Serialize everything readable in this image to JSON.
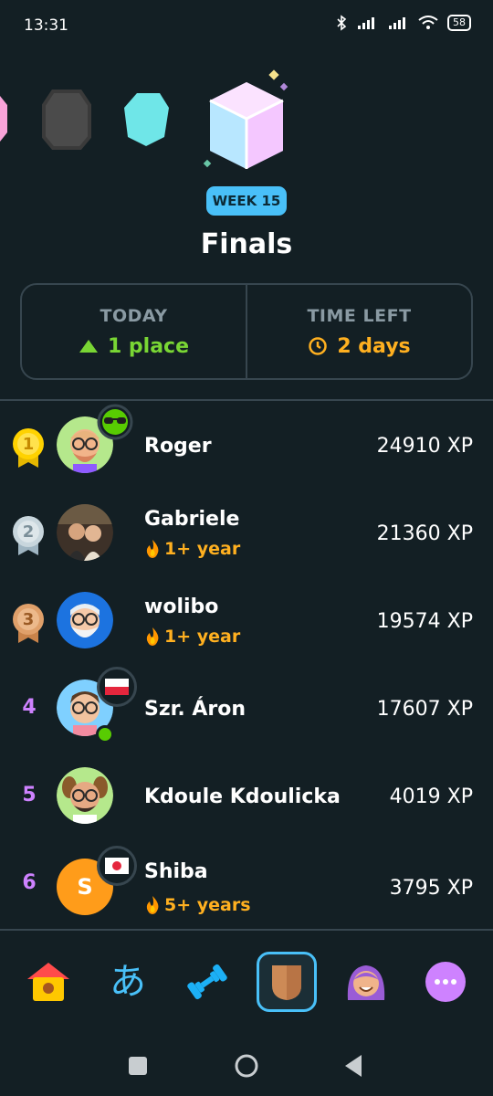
{
  "status_bar": {
    "time": "13:31",
    "battery": "58"
  },
  "league": {
    "week_badge": "WEEK 15",
    "title": "Finals",
    "today_label": "TODAY",
    "today_value": "1 place",
    "time_left_label": "TIME LEFT",
    "time_left_value": "2 days"
  },
  "leaderboard": [
    {
      "rank": "1",
      "name": "Roger",
      "xp": "24910 XP",
      "streak": ""
    },
    {
      "rank": "2",
      "name": "Gabriele",
      "xp": "21360 XP",
      "streak": "1+ year"
    },
    {
      "rank": "3",
      "name": "wolibo",
      "xp": "19574 XP",
      "streak": "1+ year"
    },
    {
      "rank": "4",
      "name": "Szr. Áron",
      "xp": "17607 XP",
      "streak": ""
    },
    {
      "rank": "5",
      "name": "Kdoule Kdoulicka",
      "xp": "4019 XP",
      "streak": ""
    },
    {
      "rank": "6",
      "name": "Shiba",
      "xp": "3795 XP",
      "streak": "5+ years",
      "avatar_letter": "S"
    }
  ],
  "nav": {
    "items": [
      "home-icon",
      "characters-icon",
      "practice-icon",
      "leaderboard-icon",
      "profile-icon",
      "more-icon"
    ],
    "characters_glyph": "あ"
  },
  "colors": {
    "background": "#131f24",
    "border": "#37464f",
    "accent_blue": "#49c0f8",
    "green": "#79d634",
    "orange": "#ffb020",
    "purple": "#ce82ff"
  }
}
